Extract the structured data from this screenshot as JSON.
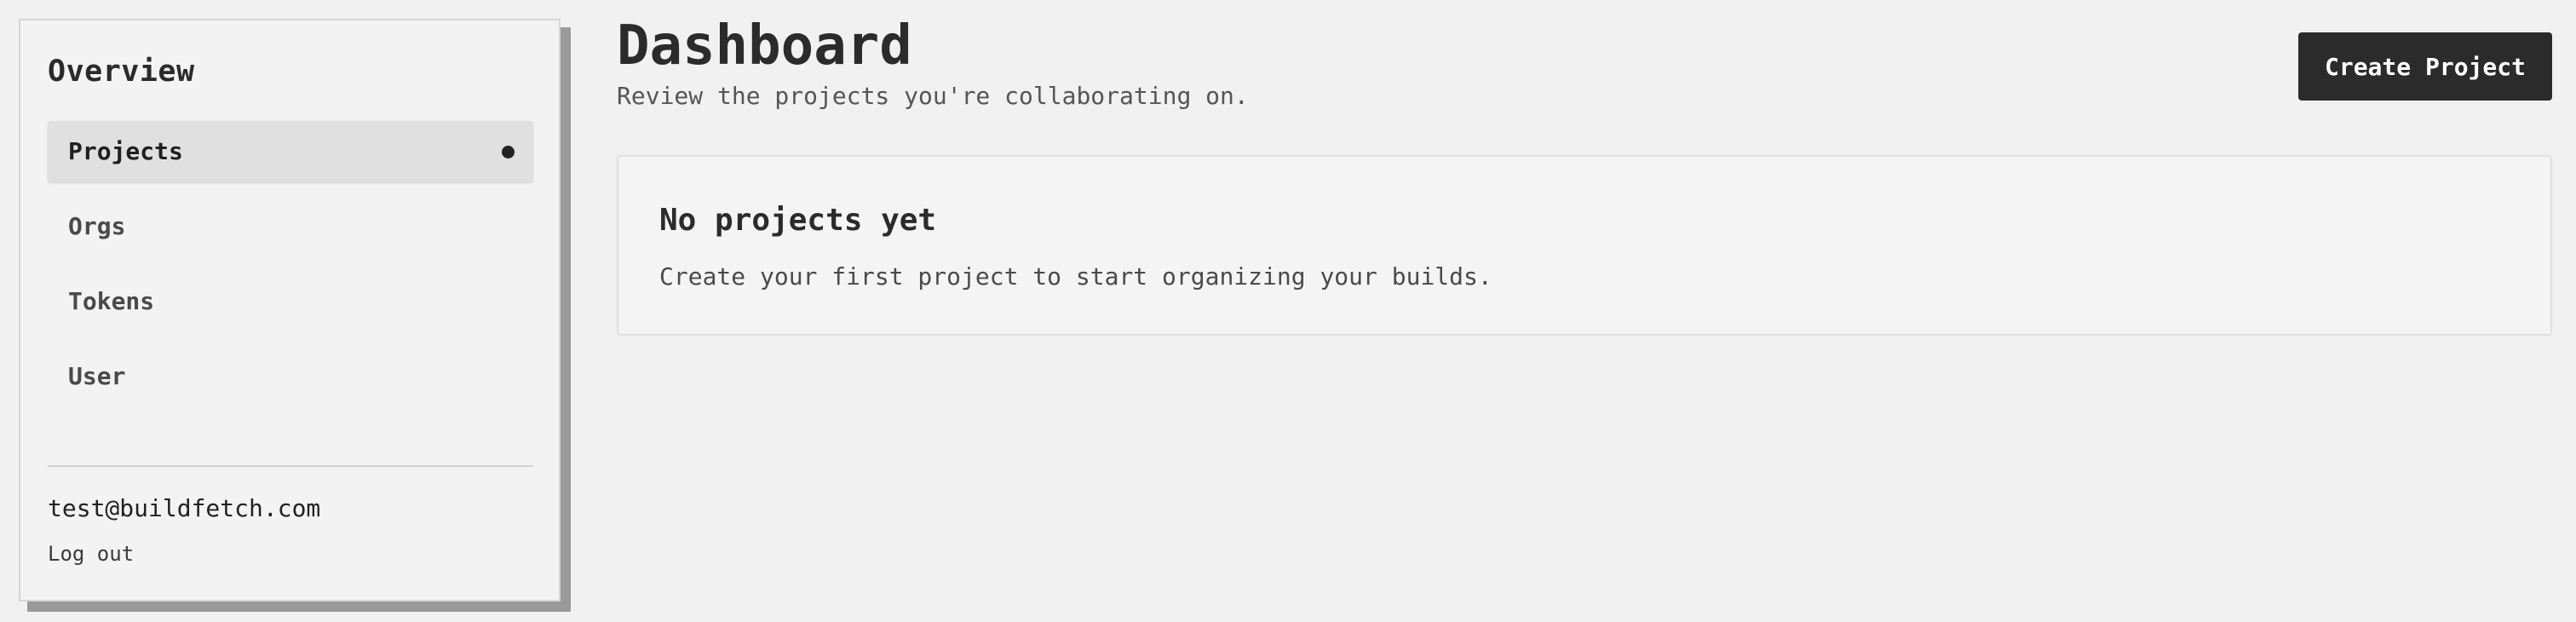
{
  "sidebar": {
    "heading": "Overview",
    "items": [
      {
        "label": "Projects",
        "active": true
      },
      {
        "label": "Orgs",
        "active": false
      },
      {
        "label": "Tokens",
        "active": false
      },
      {
        "label": "User",
        "active": false
      }
    ],
    "user_email": "test@buildfetch.com",
    "logout_label": "Log out"
  },
  "main": {
    "title": "Dashboard",
    "subtitle": "Review the projects you're collaborating on.",
    "create_button_label": "Create Project",
    "empty_state": {
      "title": "No projects yet",
      "text": "Create your first project to start organizing your builds."
    }
  },
  "colors": {
    "background": "#f1f1f1",
    "primary_button": "#2b2b2b",
    "active_nav": "#e0e0e0"
  }
}
